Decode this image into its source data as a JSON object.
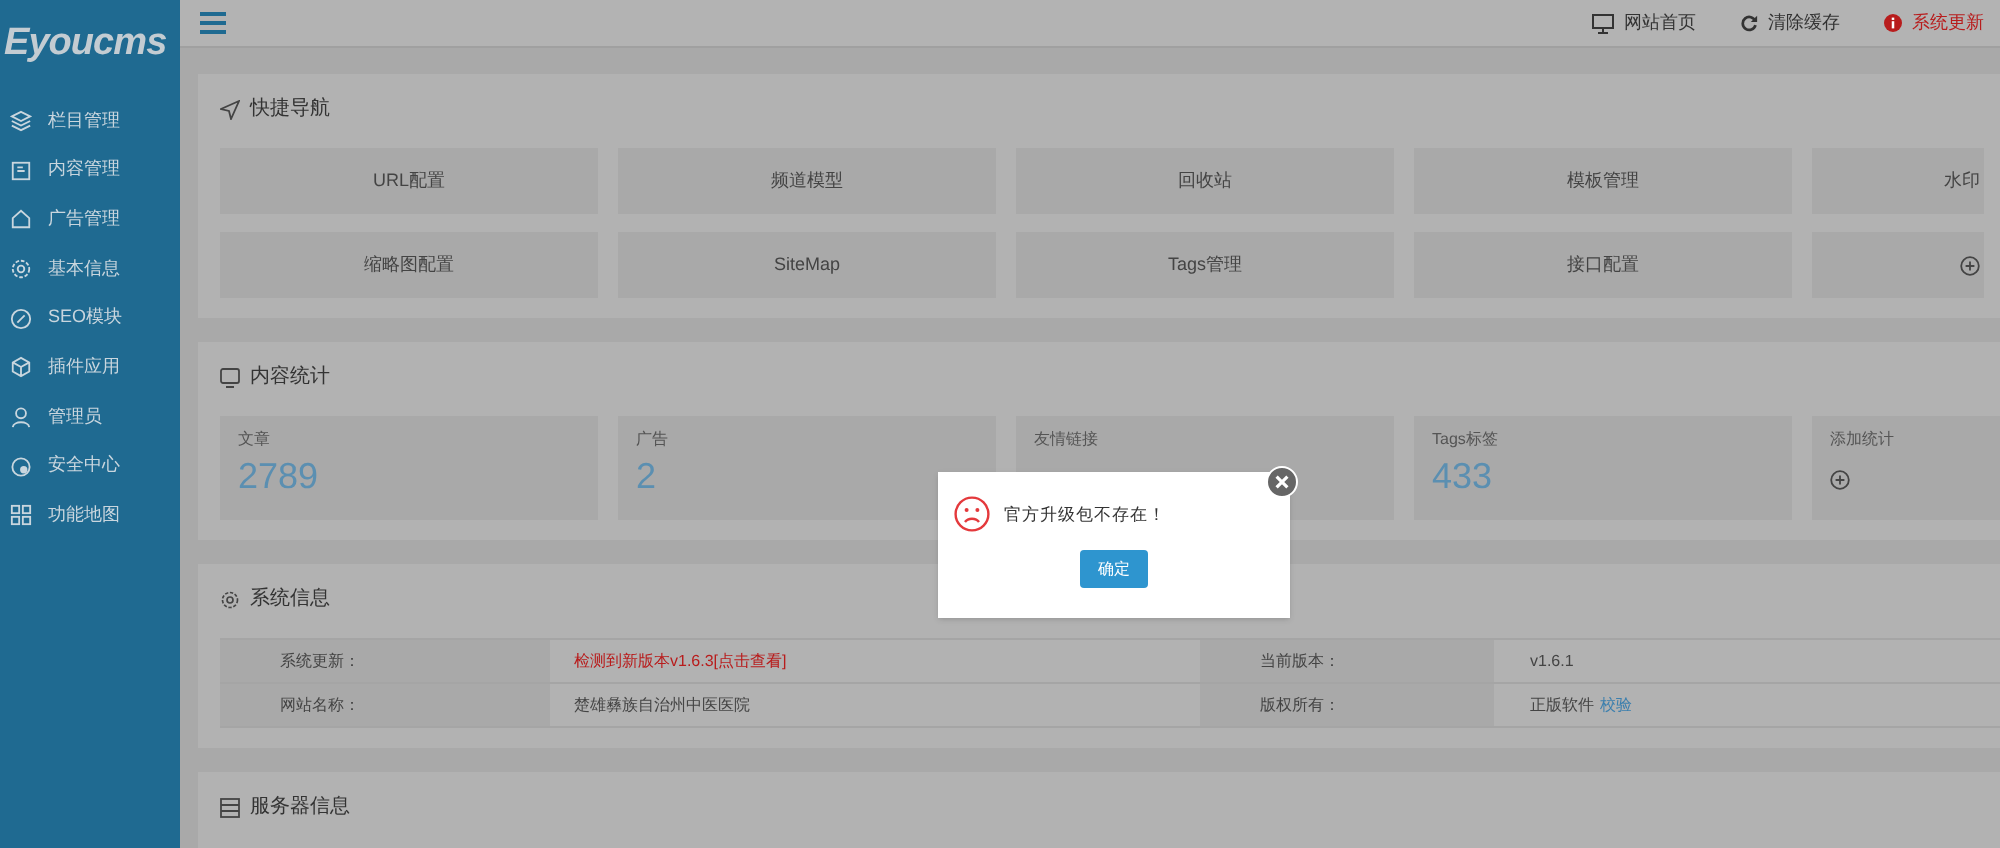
{
  "sidebar": {
    "logo": "Eyoucms",
    "items": [
      {
        "label": "栏目管理"
      },
      {
        "label": "内容管理"
      },
      {
        "label": "广告管理"
      },
      {
        "label": "基本信息"
      },
      {
        "label": "SEO模块"
      },
      {
        "label": "插件应用"
      },
      {
        "label": "管理员"
      },
      {
        "label": "安全中心"
      },
      {
        "label": "功能地图"
      }
    ]
  },
  "header": {
    "links": [
      {
        "label": "网站首页",
        "kind": "monitor"
      },
      {
        "label": "清除缓存",
        "kind": "refresh"
      },
      {
        "label": "系统更新",
        "kind": "alert"
      }
    ]
  },
  "quick_nav": {
    "title": "快捷导航",
    "tiles": [
      {
        "label": "URL配置"
      },
      {
        "label": "频道模型"
      },
      {
        "label": "回收站"
      },
      {
        "label": "模板管理"
      },
      {
        "label": "水印"
      },
      {
        "label": "缩略图配置"
      },
      {
        "label": "SiteMap"
      },
      {
        "label": "Tags管理"
      },
      {
        "label": "接口配置"
      },
      {
        "kind": "add"
      }
    ]
  },
  "stats": {
    "title": "内容统计",
    "tiles": [
      {
        "label": "文章",
        "value": "2789"
      },
      {
        "label": "广告",
        "value": "2"
      },
      {
        "label": "友情链接"
      },
      {
        "label": "Tags标签",
        "value": "433"
      },
      {
        "label": "添加统计",
        "kind": "add"
      }
    ]
  },
  "system_info": {
    "title": "系统信息",
    "rows": [
      {
        "label": "系统更新：",
        "value": "检测到新版本v1.6.3[点击查看]",
        "alert": true,
        "label_2": "当前版本：",
        "value_2": "v1.6.1"
      },
      {
        "label": "网站名称：",
        "value": "楚雄彝族自治州中医医院",
        "alert": false,
        "label_2": "版权所有：",
        "value_2": "正版软件",
        "link": "校验"
      }
    ]
  },
  "server_info": {
    "title": "服务器信息"
  },
  "dialog": {
    "message": "官方升级包不存在！",
    "button": "确定"
  }
}
